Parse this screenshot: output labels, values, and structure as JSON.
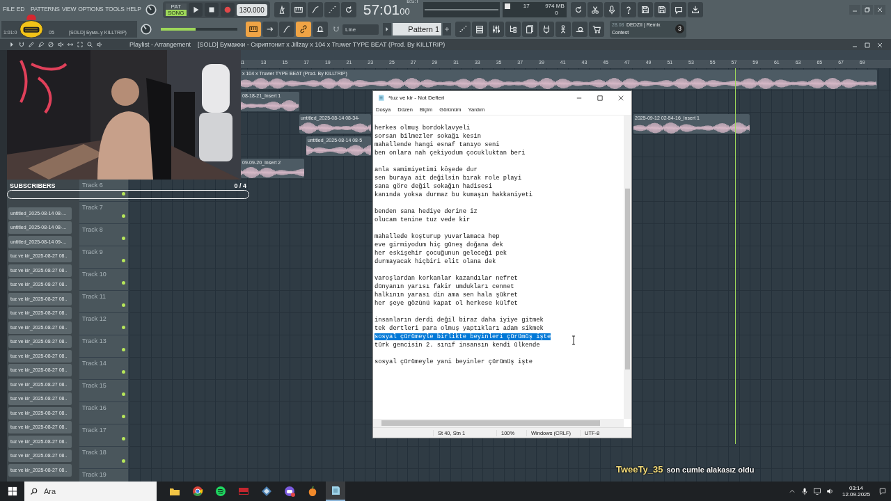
{
  "menu": [
    "FILE",
    "ED",
    "PATTERNS",
    "VIEW",
    "OPTIONS",
    "TOOLS",
    "HELP"
  ],
  "mode_toggle": [
    {
      "label": "PAT",
      "selected": false
    },
    {
      "label": "SONG",
      "selected": true
    }
  ],
  "tempo": "130.000",
  "time": {
    "value": "57:01",
    "ticks": "00",
    "unit": "B:S:T"
  },
  "cpu": {
    "voices": "17",
    "memory": "974 MB",
    "polyphony": "0"
  },
  "hint_bar": [
    "1:01:0",
    "05",
    "[SOLD] Бума..у KILLTRIP)"
  ],
  "master_volume": {
    "level": 0.45
  },
  "snap": "Line",
  "pattern": "Pattern 1",
  "news": {
    "date": "28.08",
    "title": "DEDZII | Remix",
    "subtitle": "Contest",
    "badge": "3"
  },
  "playlist_bar": {
    "title": "Playlist - Arrangement",
    "project": "[SOLD] Бумажки - Скриптонит x Jillzay x 104 x Truwer TYPE BEAT (Prod. By KILLTRIP)"
  },
  "ruler": [
    "11",
    "13",
    "15",
    "17",
    "19",
    "21",
    "23",
    "25",
    "27",
    "29",
    "31",
    "33",
    "35",
    "37",
    "39",
    "41",
    "43",
    "45",
    "47",
    "49",
    "51",
    "53",
    "55",
    "57",
    "59",
    "61",
    "63",
    "65",
    "67",
    "69"
  ],
  "clips": [
    {
      "label": "x 104 x Truwer TYPE BEAT (Prod. By KILLTRIP)"
    },
    {
      "label": "08-18-21_Insert 1"
    },
    {
      "label": "untitled_2025-08-14 08-34-"
    },
    {
      "label": "2025-09-12 02-54-16_Insert 1"
    },
    {
      "label": "untitled_2025-08-14 08-5"
    },
    {
      "label": "09-09-20_Insert 2"
    }
  ],
  "browser_items": [
    "untitled_2025-08-14 08-...",
    "untitled_2025-08-14 08-...",
    "untitled_2025-08-14 09-...",
    "tuz ve kir_2025-08-27 08..",
    "tuz ve kir_2025-08-27 08..",
    "tuz ve kir_2025-08-27 08..",
    "tuz ve kir_2025-08-27 08..",
    "tuz ve kir_2025-08-27 08..",
    "tuz ve kir_2025-08-27 08..",
    "tuz ve kir_2025-08-27 08..",
    "tuz ve kir_2025-08-27 08..",
    "tuz ve kir_2025-08-27 08..",
    "tuz ve kir_2025-08-27 08..",
    "tuz ve kir_2025-08-27 08..",
    "tuz ve kir_2025-08-27 08..",
    "tuz ve kir_2025-08-27 08..",
    "tuz ve kir_2025-08-27 08..",
    "tuz ve kir_2025-08-27 08..",
    "tuz ve kir_2025-08-27 08.."
  ],
  "tracks": [
    "Track 6",
    "Track 7",
    "Track 8",
    "Track 9",
    "Track 10",
    "Track 11",
    "Track 12",
    "Track 13",
    "Track 14",
    "Track 15",
    "Track 16",
    "Track 17",
    "Track 18",
    "Track 19"
  ],
  "subscribers": {
    "label": "SUBSCRIBERS",
    "count": "0 / 4",
    "level": 0
  },
  "notepad": {
    "title": "*tuz ve kir - Not Defteri",
    "menu": [
      "Dosya",
      "Düzen",
      "Biçim",
      "Görünüm",
      "Yardım"
    ],
    "stanzas": [
      [
        {
          "text": "herkes olmuş bordoklavyeli",
          "selected": false
        },
        {
          "text": "sorsan bilmezler sokağı kesin",
          "selected": false
        },
        {
          "text": "mahallende hangi esnaf tanıyo seni",
          "selected": false
        },
        {
          "text": "ben onlara nah çekiyodum çocukluktan beri",
          "selected": false
        }
      ],
      [
        {
          "text": "anla samimiyetimi köşede dur",
          "selected": false
        },
        {
          "text": "sen buraya ait değilsin bırak role playi",
          "selected": false
        },
        {
          "text": "sana göre değil sokağın hadisesi",
          "selected": false
        },
        {
          "text": "kanında yoksa durmaz bu kumaşın hakkaniyeti",
          "selected": false
        }
      ],
      [
        {
          "text": "benden sana hediye derine iz",
          "selected": false
        },
        {
          "text": "olucam tenine tuz vede kir",
          "selected": false
        }
      ],
      [
        {
          "text": "mahallede koşturup yuvarlamaca hep",
          "selected": false
        },
        {
          "text": "eve girmiyodum hiç güneş doğana dek",
          "selected": false
        },
        {
          "text": "her eskişehir çocuğunun geleceği pek",
          "selected": false
        },
        {
          "text": "durmayacak hiçbiri elit olana dek",
          "selected": false
        }
      ],
      [
        {
          "text": "varoşlardan korkanlar kazandılar nefret",
          "selected": false
        },
        {
          "text": "dünyanın yarısı fakir umdukları cennet",
          "selected": false
        },
        {
          "text": "halkının yarası din ama sen hala şükret",
          "selected": false
        },
        {
          "text": "her şeye gözünü kapat ol herkese külfet",
          "selected": false
        }
      ],
      [
        {
          "text": "insanların derdi değil biraz daha iyiye gitmek",
          "selected": false
        },
        {
          "text": "tek dertleri para olmuş yaptıkları adam sikmek",
          "selected": false
        },
        {
          "text": "sosyal çürümeyle birlikte beyinleri çürümüş işte",
          "selected": true
        },
        {
          "text": "türk gencisin 2. sınıf insansın kendi ülkende",
          "selected": false
        }
      ],
      [
        {
          "text": "sosyal çürümeyle yani beyinler çürümüş işte",
          "selected": false
        }
      ]
    ],
    "status": [
      "St 40, Stn 1",
      "100%",
      "Windows (CRLF)",
      "UTF-8"
    ]
  },
  "chat": {
    "user": "TweeTy_35",
    "message": "son cumle alakasız oldu"
  },
  "taskbar": {
    "search": "Ara",
    "clock": "03:14",
    "date": "12.09.2025"
  }
}
